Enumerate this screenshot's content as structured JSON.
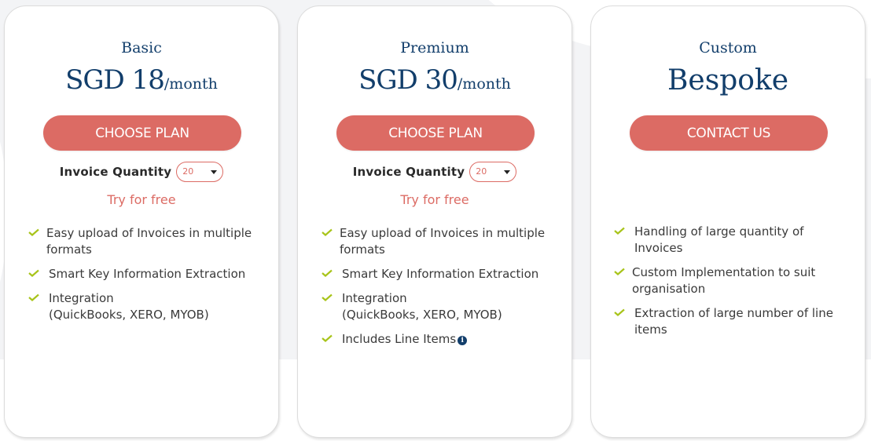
{
  "colors": {
    "accent": "#dc6b64",
    "heading": "#123e6b",
    "check": "#a8c41a",
    "background": "#f3f4f6"
  },
  "plans": [
    {
      "name": "Basic",
      "price_amount": "SGD 18",
      "price_period": "/month",
      "cta_label": "CHOOSE PLAN",
      "quantity_label": "Invoice Quantity",
      "quantity_value": "20",
      "trial_link": "Try for free",
      "features": [
        {
          "text": "Easy upload of Invoices in multiple formats",
          "icon": "check-icon"
        },
        {
          "text": "Smart Key Information Extraction",
          "icon": "check-icon"
        },
        {
          "text": "Integration (QuickBooks, XERO, MYOB)",
          "line1": "Integration",
          "line2": "(QuickBooks, XERO, MYOB)",
          "icon": "check-icon"
        }
      ]
    },
    {
      "name": "Premium",
      "price_amount": "SGD 30",
      "price_period": "/month",
      "cta_label": "CHOOSE PLAN",
      "quantity_label": "Invoice Quantity",
      "quantity_value": "20",
      "trial_link": "Try for free",
      "features": [
        {
          "text": "Easy upload of Invoices in multiple formats",
          "icon": "check-icon"
        },
        {
          "text": "Smart Key Information Extraction",
          "icon": "check-icon"
        },
        {
          "text": "Integration (QuickBooks, XERO, MYOB)",
          "line1": "Integration",
          "line2": "(QuickBooks, XERO, MYOB)",
          "icon": "check-icon"
        },
        {
          "text": "Includes Line Items",
          "icon": "check-icon",
          "extra_icon": "info-icon",
          "extra_glyph": "i"
        }
      ]
    },
    {
      "name": "Custom",
      "price_amount": "Bespoke",
      "price_period": "",
      "cta_label": "CONTACT US",
      "features": [
        {
          "text": "Handling of large quantity of Invoices",
          "icon": "check-icon"
        },
        {
          "text": "Custom Implementation to suit organisation",
          "icon": "check-icon"
        },
        {
          "text": "Extraction of large number of line items",
          "icon": "check-icon"
        }
      ]
    }
  ]
}
